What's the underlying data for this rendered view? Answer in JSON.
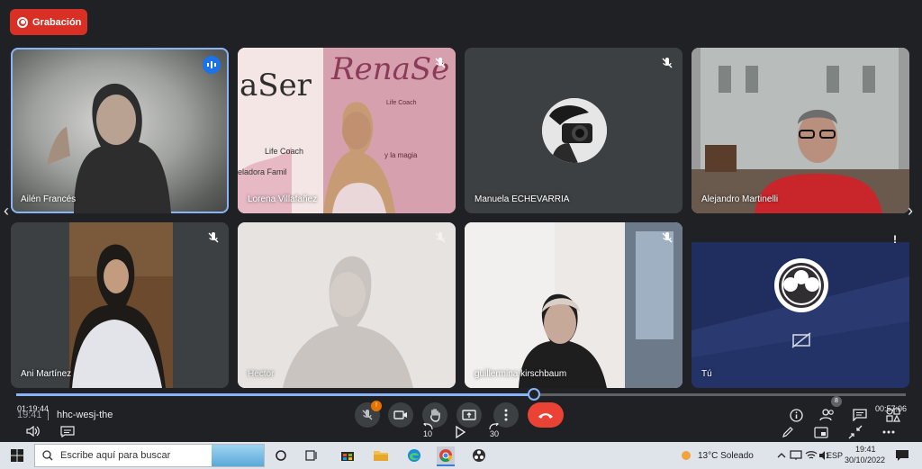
{
  "recording": {
    "label": "Grabación"
  },
  "participants": [
    {
      "name": "Ailén Francés",
      "speaking": true
    },
    {
      "name": "Lorena Villafañez",
      "muted": true,
      "sign_text": "aSer",
      "sign_text2": "RenaSe",
      "sign_small": "Life Coach",
      "sign_small2": "Life Coach",
      "sign_small3": "eladora Famil",
      "sign_small4": "y la magia"
    },
    {
      "name": "Manuela ECHEVARRIA",
      "muted": true
    },
    {
      "name": "Alejandro Martinelli"
    },
    {
      "name": "Ani Martínez",
      "muted": true
    },
    {
      "name": "Hector",
      "muted": true
    },
    {
      "name": "guillermina kirschbaum",
      "muted": true
    },
    {
      "name": "Tú",
      "notice": "!"
    }
  ],
  "player": {
    "elapsed": "01:19:44",
    "duration": "00:57:06",
    "progress_fraction": 0.582,
    "rewind_label": "10",
    "forward_label": "30"
  },
  "meeting": {
    "time": "19:41",
    "code": "hhc-wesj-the",
    "mic_badge": "!",
    "participant_count": "8"
  },
  "taskbar": {
    "search_placeholder": "Escribe aquí para buscar",
    "weather": "13°C Soleado",
    "lang": "ESP",
    "clock_time": "19:41",
    "clock_date": "30/10/2022"
  },
  "colors": {
    "accent": "#8ab4f8",
    "record": "#d93025",
    "hangup": "#ea4335",
    "speaking": "#1a73e8"
  }
}
